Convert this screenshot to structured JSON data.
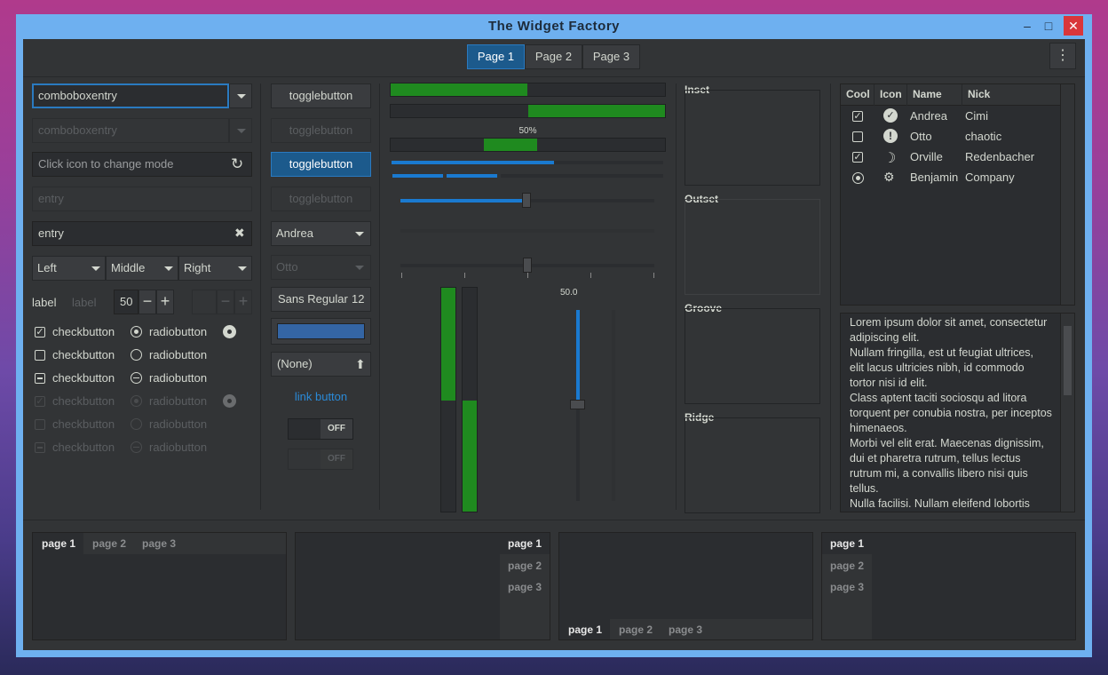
{
  "window": {
    "title": "The Widget Factory"
  },
  "header": {
    "tabs": [
      "Page 1",
      "Page 2",
      "Page 3"
    ]
  },
  "col1": {
    "combo1": "comboboxentry",
    "combo2": "comboboxentry",
    "mode_placeholder": "Click icon to change mode",
    "entry_dis": "entry",
    "entry_val": "entry",
    "seg": [
      "Left",
      "Middle",
      "Right"
    ],
    "label1": "label",
    "label2": "label",
    "spin": "50",
    "checks": [
      "checkbutton",
      "checkbutton",
      "checkbutton",
      "checkbutton",
      "checkbutton",
      "checkbutton"
    ],
    "radios": [
      "radiobutton",
      "radiobutton",
      "radiobutton",
      "radiobutton",
      "radiobutton",
      "radiobutton"
    ]
  },
  "col2": {
    "toggles": [
      "togglebutton",
      "togglebutton",
      "togglebutton",
      "togglebutton"
    ],
    "combo_a": "Andrea",
    "combo_o": "Otto",
    "font": "Sans Regular",
    "font_size": "12",
    "file": "(None)",
    "link": "link button",
    "off1": "OFF",
    "off2": "OFF"
  },
  "col3": {
    "pct": "50%",
    "scale_val": "50.0",
    "progress": {
      "bar1": 0.5,
      "bar2": 0.5,
      "bar3": 0.5,
      "vbar1": 0.6,
      "vbar2": 0.5
    },
    "slider": 0.5
  },
  "frames": [
    "Inset",
    "Outset",
    "Groove",
    "Ridge"
  ],
  "tree": {
    "headers": [
      "Cool",
      "Icon",
      "Name",
      "Nick"
    ],
    "rows": [
      {
        "name": "Andrea",
        "nick": "Cimi",
        "icon": "check-circle-icon"
      },
      {
        "name": "Otto",
        "nick": "chaotic",
        "icon": "warning-icon"
      },
      {
        "name": "Orville",
        "nick": "Redenbacher",
        "icon": "moon-icon"
      },
      {
        "name": "Benjamin",
        "nick": "Company",
        "icon": "bug-icon"
      }
    ]
  },
  "text": [
    "Lorem ipsum dolor sit amet, consectetur",
    "adipiscing elit.",
    "Nullam fringilla, est ut feugiat ultrices,",
    "elit lacus ultricies nibh, id commodo",
    "tortor nisi id elit.",
    "Class aptent taciti sociosqu ad litora",
    "torquent per conubia nostra, per inceptos",
    "himenaeos.",
    "Morbi vel elit erat. Maecenas dignissim,",
    "dui et pharetra rutrum, tellus lectus",
    "rutrum mi, a convallis libero nisi quis",
    "tellus.",
    "Nulla facilisi. Nullam eleifend lobortis"
  ],
  "notebooks": [
    [
      "page 1",
      "page 2",
      "page 3"
    ],
    [
      "page 1",
      "page 2",
      "page 3"
    ],
    [
      "page 1",
      "page 2",
      "page 3"
    ],
    [
      "page 1",
      "page 2",
      "page 3"
    ]
  ]
}
